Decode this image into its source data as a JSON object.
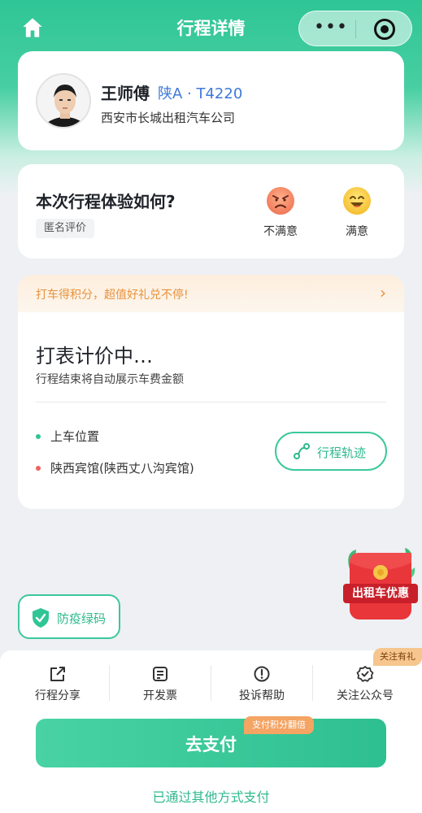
{
  "nav": {
    "title": "行程详情",
    "more_icon": "more-dots-icon",
    "close_icon": "target-close-icon",
    "home_icon": "home-icon"
  },
  "driver": {
    "name": "王师傅",
    "plate": "陕A · T4220",
    "company": "西安市长城出租汽车公司"
  },
  "rating": {
    "title": "本次行程体验如何?",
    "anonymous_label": "匿名评价",
    "options": [
      {
        "label": "不满意",
        "icon": "angry-face-icon"
      },
      {
        "label": "满意",
        "icon": "happy-face-icon"
      }
    ]
  },
  "promo": {
    "text": "打车得积分，超值好礼兑不停!",
    "chevron": "›"
  },
  "meter": {
    "title": "打表计价中…",
    "subtitle": "行程结束将自动展示车费金额"
  },
  "locations": {
    "pickup": "上车位置",
    "destination": "陕西宾馆(陕西丈八沟宾馆)"
  },
  "track_button": {
    "label": "行程轨迹"
  },
  "epidemic_button": {
    "label": "防疫绿码"
  },
  "red_packet": {
    "label": "出租车优惠"
  },
  "actions": [
    {
      "label": "行程分享",
      "icon": "share-icon"
    },
    {
      "label": "开发票",
      "icon": "invoice-icon"
    },
    {
      "label": "投诉帮助",
      "icon": "alert-icon"
    },
    {
      "label": "关注公众号",
      "icon": "verified-badge-icon"
    }
  ],
  "follow_tag": "关注有礼",
  "pay": {
    "label": "去支付",
    "tag": "支付积分翻倍",
    "other": "已通过其他方式支付"
  },
  "colors": {
    "brand": "#2fc595",
    "plate": "#3f79d9",
    "promo": "#e8923b"
  }
}
